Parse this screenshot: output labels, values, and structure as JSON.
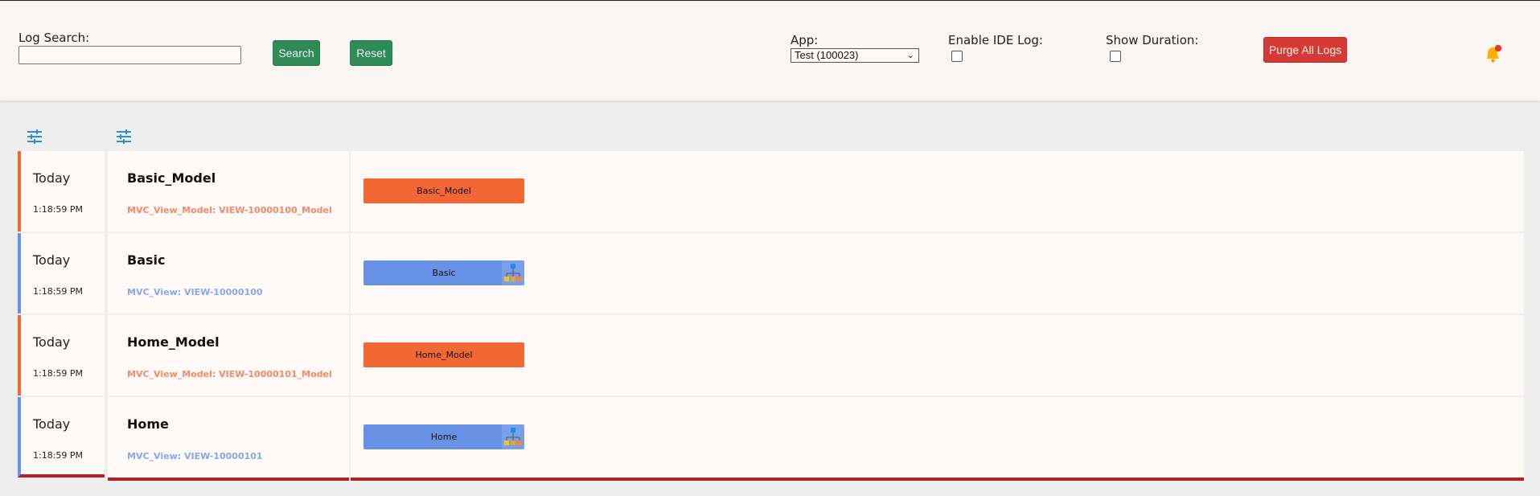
{
  "header": {
    "log_search_label": "Log Search:",
    "log_search_value": "",
    "search_button": "Search",
    "reset_button": "Reset",
    "app_label": "App:",
    "app_selected": "Test (100023)",
    "enable_ide_log_label": "Enable IDE Log:",
    "enable_ide_log_checked": false,
    "show_duration_label": "Show Duration:",
    "show_duration_checked": false,
    "purge_button": "Purge All Logs",
    "notification_icon": "bell-icon",
    "notification_has_badge": true
  },
  "toolbar": {
    "icons": [
      "filter-sliders-icon",
      "filter-sliders-icon"
    ]
  },
  "colors": {
    "model": "#f26835",
    "view": "#6792e5",
    "search_green": "#2e8b57",
    "purge_red": "#d63a36",
    "bottom_border": "#b22222"
  },
  "logs": [
    {
      "day": "Today",
      "time": "1:18:59 PM",
      "name": "Basic_Model",
      "subtitle": "MVC_View_Model: VIEW-10000100_Model",
      "bar_label": "Basic_Model",
      "type": "model"
    },
    {
      "day": "Today",
      "time": "1:18:59 PM",
      "name": "Basic",
      "subtitle": "MVC_View: VIEW-10000100",
      "bar_label": "Basic",
      "type": "view"
    },
    {
      "day": "Today",
      "time": "1:18:59 PM",
      "name": "Home_Model",
      "subtitle": "MVC_View_Model: VIEW-10000101_Model",
      "bar_label": "Home_Model",
      "type": "model"
    },
    {
      "day": "Today",
      "time": "1:18:59 PM",
      "name": "Home",
      "subtitle": "MVC_View: VIEW-10000101",
      "bar_label": "Home",
      "type": "view"
    }
  ]
}
